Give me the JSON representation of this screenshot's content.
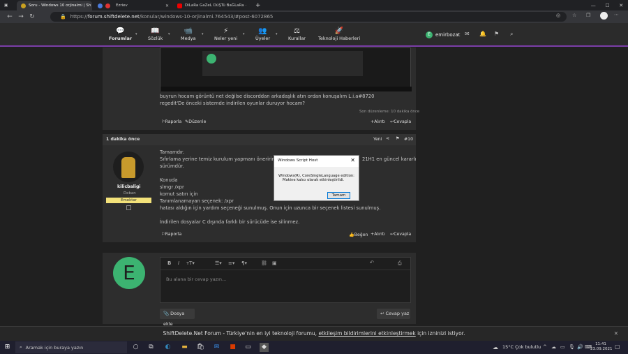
{
  "browser": {
    "tabs": [
      {
        "title": "Soru - Windows 10 orjinalmi | Sh"
      },
      {
        "title": ""
      },
      {
        "title": "Ezriev"
      },
      {
        "title": "DiLaRa GaZeL DüŞTü BaĞLaRa ·"
      }
    ],
    "url_prefix": "https://",
    "url_domain": "forum.shiftdelete.net",
    "url_path": "/konular/windows-10-orjinalmi.764543/#post-6072865"
  },
  "site_nav": {
    "items": [
      "Forumlar",
      "Sözlük",
      "Medya",
      "Neler yeni",
      "Üyeler",
      "Kurallar",
      "Teknoloji Haberleri"
    ],
    "username": "emirbozat",
    "user_initial": "E"
  },
  "post1": {
    "line1": "buyrun hocam görüntü net değilse discorddan arkadaşlık atın ordan konuşalım L.i.a#8720",
    "line2": "regedit'De önceki sistemde indirilen oyunlar duruyor hocam?",
    "edited": "Son düzenleme: 10 dakika önce",
    "report": "Raporla",
    "edit": "Düzenle",
    "quote": "Alıntı",
    "reply": "Cevapla"
  },
  "post2": {
    "time": "1 dakika önce",
    "new_label": "Yeni",
    "number": "#10",
    "author": "kilicbaligi",
    "role": "Deban",
    "badge": "Emektar",
    "lines": [
      "Tamamdır.",
      "Sıfırlama yerine temiz kurulum yapmanı öneririm. W",
      "sürümdür.",
      "",
      "Konuda",
      "slmgr /xpr",
      "komut satırı için",
      "Tanımlanamayan seçenek: /xpr",
      "hatası aldığın için yardım seçeneği sunulmuş. Onun için uzunca bir seçenek listesi sunulmuş.",
      "",
      "İndirilen dosyalar C dışında farklı bir sürücüde ise silinmez."
    ],
    "trailing_text": "21H1 en güncel kararlı",
    "report": "Raporla",
    "like": "Beğen",
    "quote": "Alıntı",
    "reply": "Cevapla"
  },
  "composer": {
    "placeholder": "Bu alana bir cevap yazın...",
    "attach": "Dosya ekle",
    "submit": "Cevap yaz",
    "avatar_initial": "E"
  },
  "dialog": {
    "title": "Windows Script Host",
    "msg1": "Windows(R), CoreSingleLanguage edition:",
    "msg2": "Makine kalıcı olarak etkinleştirildi.",
    "ok": "Tamam"
  },
  "cookie_bar": {
    "prefix": "ShiftDelete.Net Forum - Türkiye'nin en iyi teknoloji forumu, ",
    "link": "etkileşim bildirimlerini etkinleştirmek",
    "suffix": " için izninizi istiyor."
  },
  "taskbar": {
    "search": "Aramak için buraya yazın",
    "weather": "15°C  Çok bulutlu",
    "time": "11:41",
    "date": "23.09.2021"
  }
}
